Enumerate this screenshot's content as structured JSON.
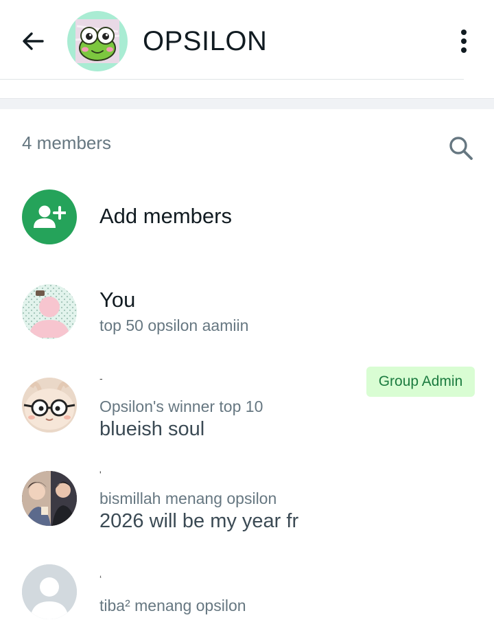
{
  "header": {
    "title": "OPSILON",
    "back_icon": "arrow-left-icon",
    "menu_icon": "more-vertical-icon"
  },
  "members": {
    "count_label": "4 members",
    "search_icon": "search-icon",
    "add_label": "Add members",
    "add_icon": "add-person-icon",
    "accent_color": "#25a35a",
    "list": [
      {
        "name": "You",
        "status": "top 50 opsilon aamiin"
      },
      {
        "name": "-",
        "subtitle": "Opsilon's winner top 10",
        "about": "blueish soul",
        "badge": "Group Admin"
      },
      {
        "name": "'",
        "subtitle": "bismillah menang opsilon",
        "about": "2026 will be my year fr"
      },
      {
        "name": "‘",
        "subtitle": "tiba² menang opsilon"
      }
    ]
  }
}
